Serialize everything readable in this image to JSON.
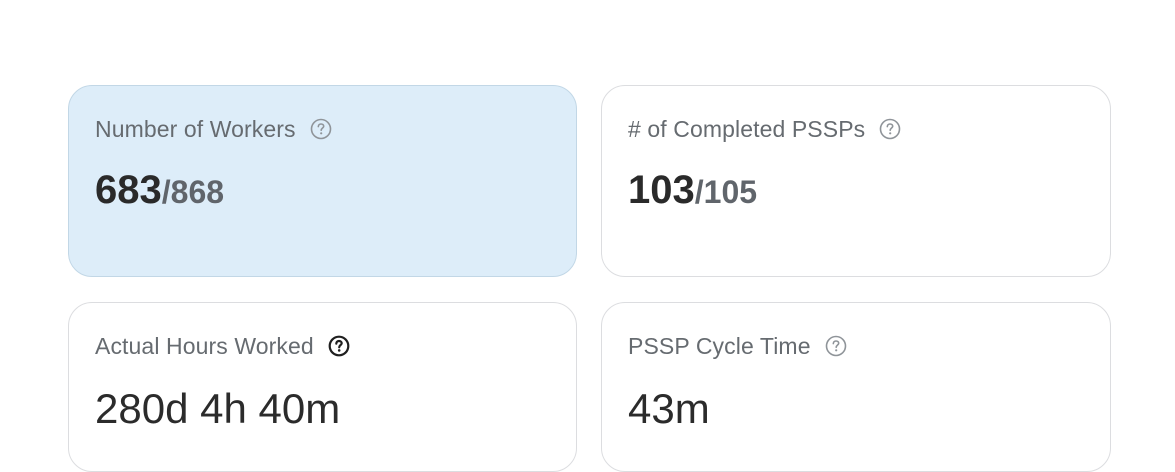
{
  "colors": {
    "active_card_bg": "#ddedf9",
    "card_border": "#dcdde0",
    "label_text": "#666b70",
    "value_text": "#2a2a2a",
    "total_text": "#60656b"
  },
  "cards": [
    {
      "label": "Number of Workers",
      "value": "683",
      "separator": "/",
      "total": "868",
      "help_icon": "question-circle-icon",
      "selected": true
    },
    {
      "label": "# of Completed PSSPs",
      "value": "103",
      "separator": "/",
      "total": "105",
      "help_icon": "question-circle-icon",
      "selected": false
    },
    {
      "label": "Actual Hours Worked",
      "value": "280d 4h 40m",
      "help_icon": "question-circle-icon",
      "selected": false
    },
    {
      "label": "PSSP Cycle Time",
      "value": "43m",
      "help_icon": "question-circle-icon",
      "selected": false
    }
  ]
}
